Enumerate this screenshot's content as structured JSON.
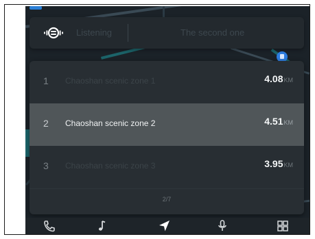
{
  "voice_bar": {
    "status": "Listening",
    "query": "The second one"
  },
  "results": {
    "items": [
      {
        "index": "1",
        "name": "Chaoshan scenic zone 1",
        "distance": "4.08",
        "unit": "KM",
        "selected": false
      },
      {
        "index": "2",
        "name": "Chaoshan scenic zone 2",
        "distance": "4.51",
        "unit": "KM",
        "selected": true
      },
      {
        "index": "3",
        "name": "Chaoshan scenic zone 3",
        "distance": "3.95",
        "unit": "KM",
        "selected": false
      }
    ],
    "page_indicator": "2/7"
  },
  "dock": {
    "items": [
      {
        "name": "phone-icon"
      },
      {
        "name": "music-note-icon"
      },
      {
        "name": "navigation-arrow-icon"
      },
      {
        "name": "microphone-icon"
      },
      {
        "name": "apps-grid-icon"
      }
    ]
  },
  "colors": {
    "accent": "#2d7de0",
    "selected_row": "#505659",
    "panel": "#282e33"
  }
}
